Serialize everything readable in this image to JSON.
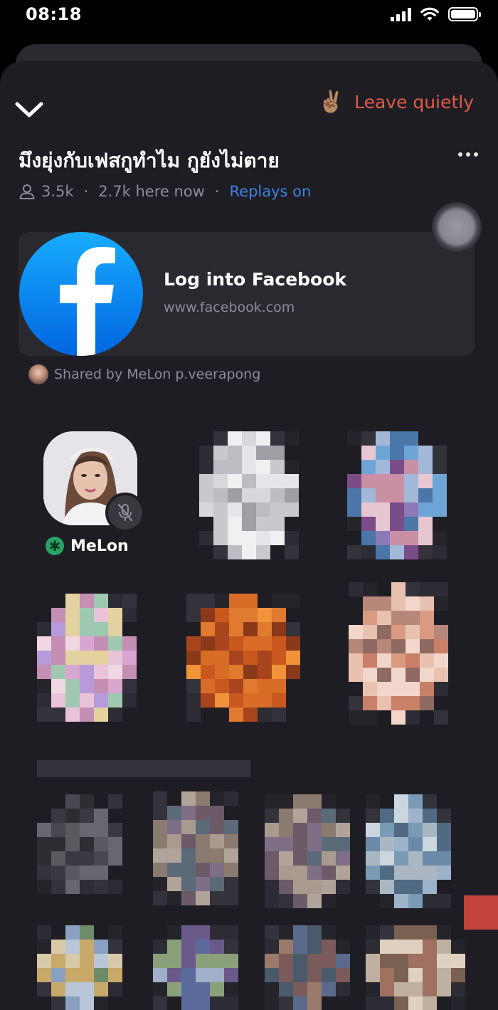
{
  "status_bar": {
    "time": "08:18"
  },
  "header": {
    "leave_emoji": "✌🏽",
    "leave_label": "Leave quietly"
  },
  "room": {
    "title": "มึงยุ่งกับเฟสกูทำไม กูยังไม่ตาย",
    "listeners": "3.5k",
    "here_now": "2.7k here now",
    "replays": "Replays on"
  },
  "link_card": {
    "title": "Log into Facebook",
    "url": "www.facebook.com"
  },
  "shared_by": "Shared by MeLon p.veerapong",
  "host": {
    "name": "MeLon",
    "badge_icon": "moderator-asterisk-icon",
    "mic_icon": "mic-muted-icon"
  },
  "colors": {
    "background": "#1f1d24",
    "card": "#2b2930",
    "leave_accent": "#e05a47",
    "link_blue": "#3b82e0",
    "moderator_green": "#27a567",
    "facebook_blue": "#1877f2"
  }
}
